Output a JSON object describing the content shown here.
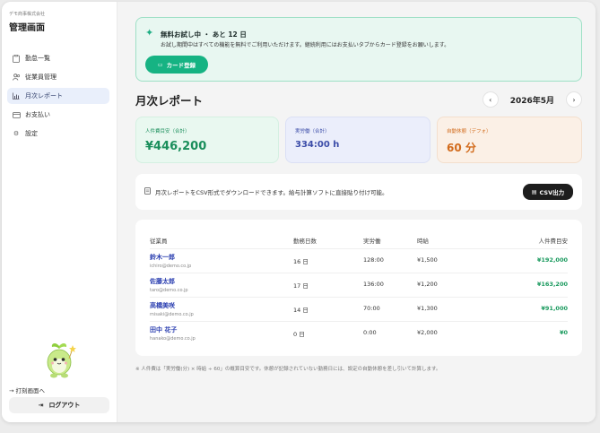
{
  "sidebar": {
    "company": "デモ商事株式会社",
    "title": "管理画面",
    "items": [
      {
        "label": "勤怠一覧",
        "icon": "clipboard-icon",
        "active": false
      },
      {
        "label": "従業員管理",
        "icon": "users-icon",
        "active": false
      },
      {
        "label": "月次レポート",
        "icon": "bar-chart-icon",
        "active": true
      },
      {
        "label": "お支払い",
        "icon": "credit-card-icon",
        "active": false
      },
      {
        "label": "設定",
        "icon": "gear-icon",
        "active": false
      }
    ],
    "switch_link": "→ 打刻画面へ",
    "logout_label": "ログアウト"
  },
  "trial": {
    "title": "無料お試し中 ・ あと 12 日",
    "description": "お試し期間中はすべての機能を無料でご利用いただけます。継続利用にはお支払いタブからカード登録をお願いします。",
    "button_label": "カード登録"
  },
  "report": {
    "title": "月次レポート",
    "month": "2026年5月",
    "prev_icon": "chevron-left-icon",
    "next_icon": "chevron-right-icon"
  },
  "kpis": {
    "labor_cost": {
      "label": "人件費目安（合計）",
      "value": "¥446,200"
    },
    "work_hours": {
      "label": "実労働（合計）",
      "value": "334:00 h"
    },
    "auto_break": {
      "label": "自動休憩（デフォ）",
      "value": "60 分"
    }
  },
  "csv": {
    "text": "月次レポートをCSV形式でダウンロードできます。給与計算ソフトに直接貼り付け可能。",
    "button_label": "CSV出力"
  },
  "table": {
    "headers": [
      "従業員",
      "勤務日数",
      "実労働",
      "時給",
      "人件費目安"
    ],
    "rows": [
      {
        "name": "鈴木一郎",
        "email": "ichiro@demo.co.jp",
        "days": "16 日",
        "hours": "128:00",
        "wage": "¥1,500",
        "cost": "¥192,000"
      },
      {
        "name": "佐藤太郎",
        "email": "taro@demo.co.jp",
        "days": "17 日",
        "hours": "136:00",
        "wage": "¥1,200",
        "cost": "¥163,200"
      },
      {
        "name": "高橋美咲",
        "email": "misaki@demo.co.jp",
        "days": "14 日",
        "hours": "70:00",
        "wage": "¥1,300",
        "cost": "¥91,000"
      },
      {
        "name": "田中 花子",
        "email": "hanako@demo.co.jp",
        "days": "0 日",
        "hours": "0:00",
        "wage": "¥2,000",
        "cost": "¥0"
      }
    ]
  },
  "footnote": "※ 人件費は「実労働(分) × 時給 ÷ 60」の概算目安です。休憩が記録されていない勤務日には、設定の自動休憩を差し引いて計算します。",
  "colors": {
    "accent_green": "#16b383",
    "active_nav": "#e9effb"
  }
}
